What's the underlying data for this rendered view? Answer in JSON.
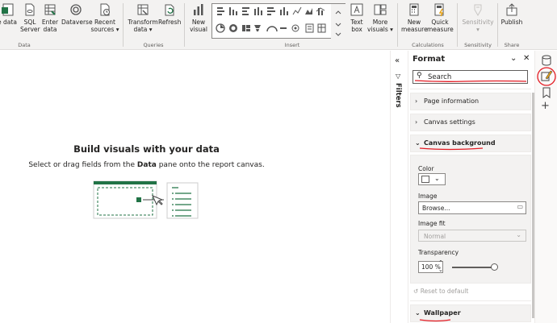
{
  "ribbon": {
    "data_items": [
      {
        "label": "e data",
        "label2": "",
        "icon": "excel-icon"
      },
      {
        "label": "SQL",
        "label2": "Server",
        "icon": "sql-server-icon"
      },
      {
        "label": "Enter",
        "label2": "data",
        "icon": "table-icon"
      },
      {
        "label": "Dataverse",
        "label2": "",
        "icon": "dataverse-icon"
      },
      {
        "label": "Recent",
        "label2": "sources ▾",
        "icon": "recent-sources-icon"
      }
    ],
    "queries_items": [
      {
        "label": "Transform",
        "label2": "data ▾",
        "icon": "transform-data-icon"
      },
      {
        "label": "Refresh",
        "label2": "",
        "icon": "refresh-icon"
      }
    ],
    "new_visual": {
      "label": "New",
      "label2": "visual"
    },
    "text_box": {
      "label": "Text",
      "label2": "box"
    },
    "more_visuals": {
      "label": "More",
      "label2": "visuals ▾"
    },
    "new_measure": {
      "label": "New",
      "label2": "measure"
    },
    "quick_measure": {
      "label": "Quick",
      "label2": "measure"
    },
    "sensitivity": {
      "label": "Sensitivity",
      "label2": "▾"
    },
    "publish": {
      "label": "Publish",
      "label2": ""
    },
    "groups": {
      "data": "Data",
      "queries": "Queries",
      "insert": "Insert",
      "calculations": "Calculations",
      "sensitivity": "Sensitivity",
      "share": "Share"
    }
  },
  "canvas": {
    "heading": "Build visuals with your data",
    "sub_before": "Select or drag fields from the ",
    "sub_bold": "Data",
    "sub_after": " pane onto the report canvas."
  },
  "filters": {
    "label": "Filters"
  },
  "format_pane": {
    "title": "Format",
    "search_placeholder": "Search",
    "sections": {
      "page_info": "Page information",
      "canvas_settings": "Canvas settings",
      "canvas_background": "Canvas background",
      "wallpaper": "Wallpaper"
    },
    "color_label": "Color",
    "image_label": "Image",
    "image_value": "Browse...",
    "image_fit_label": "Image fit",
    "image_fit_value": "Normal",
    "transparency_label": "Transparency",
    "transparency_value": "100 %",
    "transparency_level": 1.0,
    "reset": "Reset to default"
  },
  "colors": {
    "accent": "#217346",
    "annotation": "#e31b23"
  }
}
